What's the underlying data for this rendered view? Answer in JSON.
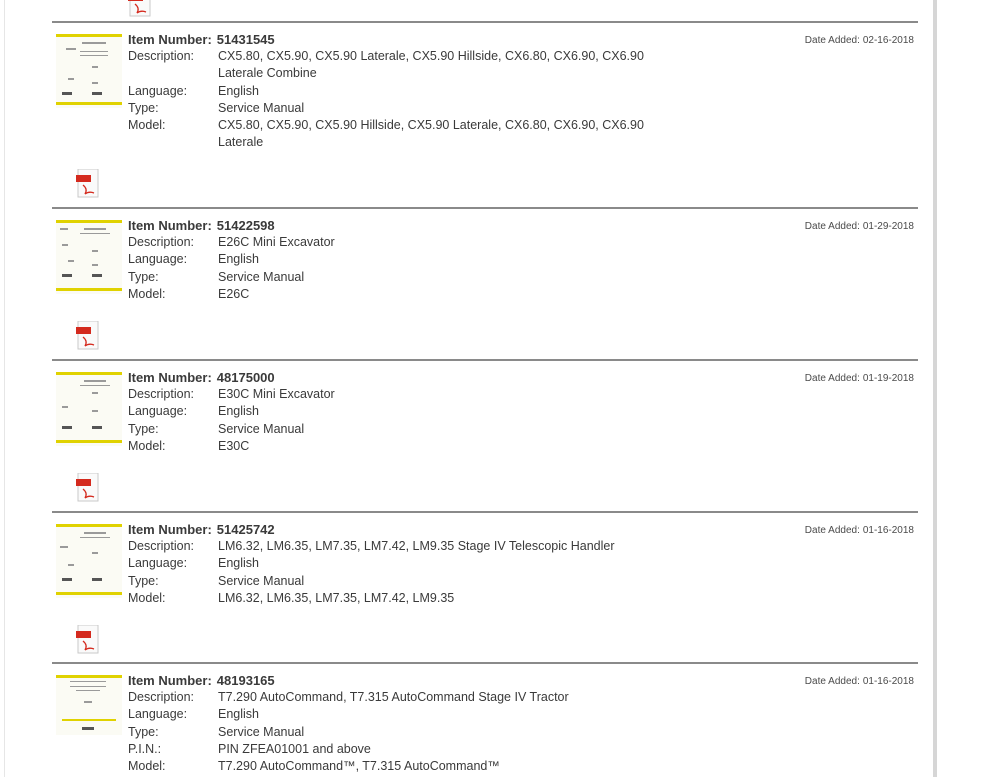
{
  "labels": {
    "item_number": "Item Number:",
    "description": "Description:",
    "language": "Language:",
    "type": "Type:",
    "model": "Model:",
    "pin": "P.I.N.:",
    "date_added": "Date Added:"
  },
  "entries": [
    {
      "item_number": "51431545",
      "description": "CX5.80, CX5.90, CX5.90 Laterale, CX5.90 Hillside, CX6.80, CX6.90, CX6.90 Laterale Combine",
      "language": "English",
      "type": "Service Manual",
      "model": "CX5.80, CX5.90, CX5.90 Hillside, CX5.90 Laterale, CX6.80, CX6.90, CX6.90 Laterale",
      "date_added": "02-16-2018"
    },
    {
      "item_number": "51422598",
      "description": "E26C Mini Excavator",
      "language": "English",
      "type": "Service Manual",
      "model": "E26C",
      "date_added": "01-29-2018"
    },
    {
      "item_number": "48175000",
      "description": "E30C Mini Excavator",
      "language": "English",
      "type": "Service Manual",
      "model": "E30C",
      "date_added": "01-19-2018"
    },
    {
      "item_number": "51425742",
      "description": "LM6.32, LM6.35, LM7.35, LM7.42, LM9.35 Stage IV Telescopic Handler",
      "language": "English",
      "type": "Service Manual",
      "model": "LM6.32, LM6.35, LM7.35, LM7.42, LM9.35",
      "date_added": "01-16-2018"
    },
    {
      "item_number": "48193165",
      "description": "T7.290 AutoCommand, T7.315 AutoCommand Stage IV Tractor",
      "language": "English",
      "type": "Service Manual",
      "pin": "PIN ZFEA01001 and above",
      "model": "T7.290 AutoCommand™, T7.315 AutoCommand™",
      "date_added": "01-16-2018"
    }
  ],
  "colors": {
    "divider": "#8a8a8a",
    "thumb_band": "#e0d200",
    "pdf_red": "#d42a1e"
  },
  "icons": [
    "pdf-icon",
    "manual-thumbnail"
  ]
}
